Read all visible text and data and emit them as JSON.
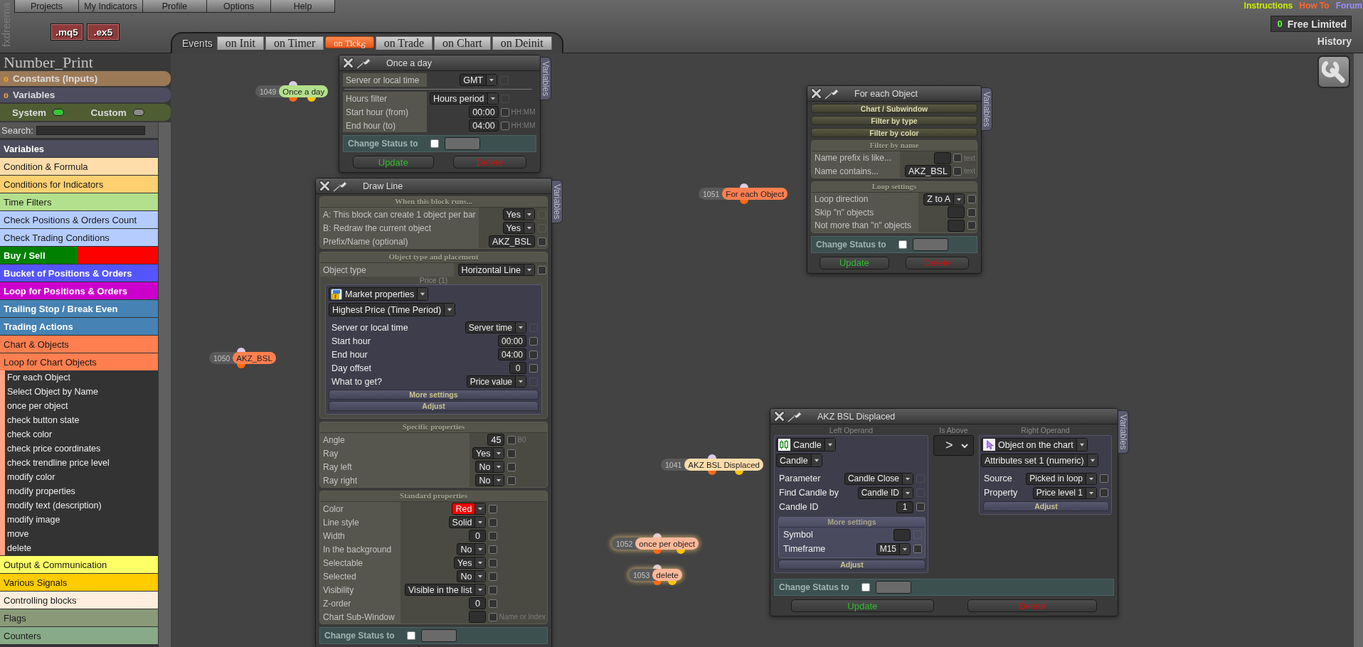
{
  "header": {
    "logo": "fxdreema",
    "menu": [
      {
        "label": "Projects"
      },
      {
        "label": "My Indicators"
      },
      {
        "label": "Profile"
      },
      {
        "label": "Options"
      },
      {
        "label": "Help"
      }
    ],
    "export_buttons": [
      {
        "label": ".mq5"
      },
      {
        "label": ".ex5"
      }
    ],
    "links": [
      {
        "label": "Instructions",
        "color": "#ccee00"
      },
      {
        "label": "How To",
        "color": "#ff6633"
      },
      {
        "label": "Forum",
        "color": "#9a8cff"
      }
    ],
    "plan": {
      "count": "0",
      "name": "Free Limited"
    },
    "history": "History"
  },
  "events": {
    "label": "Events",
    "tabs": [
      {
        "label": "on Init",
        "selected": false
      },
      {
        "label": "on Timer",
        "selected": false
      },
      {
        "label": "on Tick",
        "count": "6",
        "selected": true
      },
      {
        "label": "on Trade",
        "selected": false
      },
      {
        "label": "on Chart",
        "selected": false
      },
      {
        "label": "on Deinit",
        "selected": false
      }
    ]
  },
  "sidebar": {
    "project": "Number_Print",
    "sections": [
      {
        "marker": "o",
        "label": "Constants (Inputs)",
        "color": "#9c7a58"
      },
      {
        "marker": "o",
        "label": "Variables",
        "color": "#4d4d5f"
      }
    ],
    "toggles": [
      {
        "label": "System",
        "on": true
      },
      {
        "label": "Custom",
        "on": false
      }
    ],
    "search": {
      "label": "Search:"
    },
    "categories": [
      {
        "label": "Variables",
        "color": "#4d4d5d"
      },
      {
        "label": "Condition & Formula",
        "color": "#ffddaa"
      },
      {
        "label": "Conditions for Indicators",
        "color": "#ffd070"
      },
      {
        "label": "Time Filters",
        "color": "#b3e08c"
      },
      {
        "label": "Check Positions & Orders Count",
        "color": "#b4ccff"
      },
      {
        "label": "Check Trading Conditions",
        "color": "#b4ccff"
      },
      {
        "label": "Buy / Sell",
        "color": "#008000",
        "band": {
          "color": "#ff0000"
        }
      },
      {
        "label": "Bucket of Positions & Orders",
        "color": "#5555ff"
      },
      {
        "label": "Loop for Positions & Orders",
        "color": "#cc00cc"
      },
      {
        "label": "Trailing Stop / Break Even",
        "color": "#4682b4"
      },
      {
        "label": "Trading Actions",
        "color": "#4682b4"
      },
      {
        "label": "Chart & Objects",
        "color": "#ff7f50"
      },
      {
        "label": "Loop for Chart Objects",
        "color": "#ff7f50",
        "children": [
          {
            "label": "For each Object"
          },
          {
            "label": "Select Object by Name"
          },
          {
            "label": "once per object"
          },
          {
            "label": "check button state"
          },
          {
            "label": "check color"
          },
          {
            "label": "check price coordinates"
          },
          {
            "label": "check trendline price level"
          },
          {
            "label": "modify color"
          },
          {
            "label": "modify properties"
          },
          {
            "label": "modify text (description)"
          },
          {
            "label": "modify image"
          },
          {
            "label": "move"
          },
          {
            "label": "delete"
          }
        ]
      },
      {
        "label": "Output & Communication",
        "color": "#ffff66"
      },
      {
        "label": "Various Signals",
        "color": "#ffcc00"
      },
      {
        "label": "Controlling blocks",
        "color": "#ffeedd"
      },
      {
        "label": "Flags",
        "color": "#8a9a78"
      },
      {
        "label": "Counters",
        "color": "#88aa88"
      }
    ]
  },
  "canvas": {
    "nodes": [
      {
        "id": "1049",
        "label": "Once a day",
        "color": "#b3e08c",
        "second_output": true,
        "highlighted": false,
        "children": [
          {
            "id": "1050",
            "label": "AKZ_BSL",
            "color": "#ff7f50",
            "second_output": false,
            "highlighted": false
          }
        ]
      },
      {
        "id": "1051",
        "label": "For each Object",
        "color": "#ff7f50",
        "second_output": false,
        "highlighted": false,
        "children": [
          {
            "id": "1041",
            "label": "AKZ BSL Displaced",
            "color": "#ffdcaa",
            "second_output": true,
            "highlighted": false,
            "children": [
              {
                "id": "1052",
                "label": "once per object",
                "color": "#ffb899",
                "second_output": true,
                "highlighted": true,
                "children": [
                  {
                    "id": "1053",
                    "label": "delete",
                    "color": "#ffb899",
                    "second_output": true,
                    "highlighted": true
                  }
                ]
              }
            ]
          }
        ]
      }
    ],
    "panels": [
      {
        "kind": "form",
        "title": "Once a day",
        "side_tab": "Variables",
        "blocks": [
          {
            "kind": "plain",
            "rows": [
              {
                "label": "Server or local time",
                "kind": "select",
                "value": "GMT",
                "checked": false,
                "check_disabled": true
              }
            ]
          },
          {
            "kind": "plain",
            "rows": [
              {
                "label": "Hours filter",
                "kind": "select",
                "value": "Hours period",
                "checked": false,
                "check_disabled": true
              },
              {
                "label": "Start hour (from)",
                "kind": "input",
                "value": "00:00",
                "checked": false,
                "check_disabled": false,
                "hint": "HH:MM"
              },
              {
                "label": "End hour (to)",
                "kind": "input",
                "value": "04:00",
                "checked": false,
                "check_disabled": false,
                "hint": "HH:MM"
              }
            ]
          }
        ],
        "status": {
          "label": "Change Status to",
          "checked": false
        },
        "buttons": [
          {
            "label": "Update",
            "kind": "update"
          },
          {
            "label": "Delete",
            "kind": "delete"
          }
        ]
      },
      {
        "kind": "form",
        "title": "Draw Line",
        "side_tab": "Variables",
        "blocks": [
          {
            "kind": "section",
            "title": "When this block runs...",
            "rows": [
              {
                "label": "A: This block can create 1 object per bar",
                "kind": "select",
                "value": "Yes",
                "checked": false,
                "check_disabled": true
              },
              {
                "label": "B: Redraw the current object",
                "kind": "select",
                "value": "Yes",
                "checked": false,
                "check_disabled": true
              },
              {
                "label": "Prefix/Name (optional)",
                "kind": "input",
                "value": "AKZ_BSL",
                "checked": false,
                "check_disabled": false
              }
            ]
          },
          {
            "kind": "section",
            "title": "Object type and placement",
            "rows": [
              {
                "label": "Object type",
                "kind": "select",
                "value": "Horizontal Line",
                "checked": false,
                "check_disabled": false
              }
            ],
            "source": {
              "caption": "Price (1)",
              "selectors": [
                {
                  "kind": "market",
                  "value": "Market properties"
                },
                {
                  "kind": "plain",
                  "value": "Highest Price (Time Period)"
                }
              ],
              "rows": [
                {
                  "label": "Server or local time",
                  "kind": "select",
                  "value": "Server time",
                  "checked": false,
                  "check_disabled": true
                },
                {
                  "label": "Start hour",
                  "kind": "input",
                  "value": "00:00",
                  "checked": false,
                  "check_disabled": false
                },
                {
                  "label": "End hour",
                  "kind": "input",
                  "value": "04:00",
                  "checked": false,
                  "check_disabled": false
                },
                {
                  "label": "Day offset",
                  "kind": "input",
                  "value": "0",
                  "checked": false,
                  "check_disabled": false
                },
                {
                  "label": "What to get?",
                  "kind": "select",
                  "value": "Price value",
                  "checked": false,
                  "check_disabled": true
                }
              ],
              "bars": [
                {
                  "label": "More settings"
                },
                {
                  "label": "Adjust"
                }
              ]
            }
          },
          {
            "kind": "section",
            "title": "Specific properties",
            "rows": [
              {
                "label": "Angle",
                "kind": "input",
                "value": "45",
                "checked": false,
                "check_disabled": false,
                "hint": "B0"
              },
              {
                "label": "Ray",
                "kind": "select",
                "value": "Yes",
                "checked": false,
                "check_disabled": false
              },
              {
                "label": "Ray left",
                "kind": "select",
                "value": "No",
                "checked": false,
                "check_disabled": false
              },
              {
                "label": "Ray right",
                "kind": "select",
                "value": "No",
                "checked": false,
                "check_disabled": false
              }
            ]
          },
          {
            "kind": "section",
            "title": "Standard properties",
            "rows": [
              {
                "label": "Color",
                "kind": "select",
                "value": "Red",
                "color": "#ff0000",
                "checked": false,
                "check_disabled": false
              },
              {
                "label": "Line style",
                "kind": "select",
                "value": "Solid",
                "checked": false,
                "check_disabled": false
              },
              {
                "label": "Width",
                "kind": "input",
                "value": "0",
                "checked": false,
                "check_disabled": false
              },
              {
                "label": "In the background",
                "kind": "select",
                "value": "No",
                "checked": false,
                "check_disabled": false
              },
              {
                "label": "Selectable",
                "kind": "select",
                "value": "Yes",
                "checked": false,
                "check_disabled": false
              },
              {
                "label": "Selected",
                "kind": "select",
                "value": "No",
                "checked": false,
                "check_disabled": false
              },
              {
                "label": "Visibility",
                "kind": "select",
                "value": "Visible in the list",
                "checked": false,
                "check_disabled": false
              },
              {
                "label": "Z-order",
                "kind": "input",
                "value": "0",
                "checked": false,
                "check_disabled": false
              },
              {
                "label": "Chart Sub-Window",
                "kind": "input",
                "checked": false,
                "check_disabled": false,
                "hint": "Name or Index"
              }
            ]
          }
        ],
        "status": {
          "label": "Change Status to",
          "checked": false
        }
      },
      {
        "kind": "form",
        "title": "For each Object",
        "side_tab": "Variables",
        "blocks": [
          {
            "kind": "bar",
            "label": "Chart / Subwindow"
          },
          {
            "kind": "bar",
            "label": "Filter by type"
          },
          {
            "kind": "bar",
            "label": "Filter by color"
          },
          {
            "kind": "section",
            "title": "Filter by name",
            "rows": [
              {
                "label": "Name prefix is like...",
                "kind": "input",
                "checked": false,
                "check_disabled": false,
                "hint": "text"
              },
              {
                "label": "Name contains...",
                "kind": "input",
                "value": "AKZ_BSL",
                "checked": false,
                "check_disabled": false,
                "hint": "text"
              }
            ]
          },
          {
            "kind": "section",
            "title": "Loop settings",
            "rows": [
              {
                "label": "Loop direction",
                "kind": "select",
                "value": "Z to A",
                "checked": false,
                "check_disabled": false
              },
              {
                "label": "Skip \"n\" objects",
                "kind": "input",
                "checked": false,
                "check_disabled": false
              },
              {
                "label": "Not more than \"n\" objects",
                "kind": "input",
                "checked": false,
                "check_disabled": false
              }
            ]
          }
        ],
        "status": {
          "label": "Change Status to",
          "checked": false
        },
        "buttons": [
          {
            "label": "Update",
            "kind": "update"
          },
          {
            "label": "Delete",
            "kind": "delete"
          }
        ]
      },
      {
        "kind": "condition",
        "title": "AKZ BSL Displaced",
        "side_tab": "Variables",
        "left": {
          "label": "Left Operand",
          "selectors": [
            {
              "kind": "candle",
              "value": "Candle"
            },
            {
              "kind": "plain",
              "value": "Candle"
            }
          ],
          "rows": [
            {
              "label": "Parameter",
              "kind": "select",
              "value": "Candle Close",
              "checked": false,
              "check_disabled": true
            },
            {
              "label": "Find Candle by",
              "kind": "select",
              "value": "Candle ID",
              "checked": false,
              "check_disabled": true
            },
            {
              "label": "Candle ID",
              "kind": "input",
              "value": "1",
              "checked": false,
              "check_disabled": false
            }
          ],
          "more": {
            "label": "More settings",
            "rows": [
              {
                "label": "Symbol",
                "kind": "input",
                "checked": false,
                "check_disabled": true
              },
              {
                "label": "Timeframe",
                "kind": "select",
                "value": "M15",
                "checked": false,
                "check_disabled": false
              }
            ]
          },
          "bars": [
            {
              "label": "Adjust"
            }
          ]
        },
        "operator": {
          "label": "Is Above",
          "value": ">"
        },
        "right": {
          "label": "Right Operand",
          "selectors": [
            {
              "kind": "object",
              "value": "Object on the chart"
            },
            {
              "kind": "plain",
              "value": "Attributes set 1 (numeric)"
            }
          ],
          "rows": [
            {
              "label": "Source",
              "kind": "select",
              "value": "Picked in loop",
              "checked": false,
              "check_disabled": false
            },
            {
              "label": "Property",
              "kind": "select",
              "value": "Price level 1",
              "checked": false,
              "check_disabled": false
            }
          ],
          "bars": [
            {
              "label": "Adjust"
            }
          ]
        },
        "status": {
          "label": "Change Status to",
          "checked": false
        },
        "buttons": [
          {
            "label": "Update",
            "kind": "update"
          },
          {
            "label": "Delete",
            "kind": "delete"
          }
        ]
      }
    ]
  }
}
